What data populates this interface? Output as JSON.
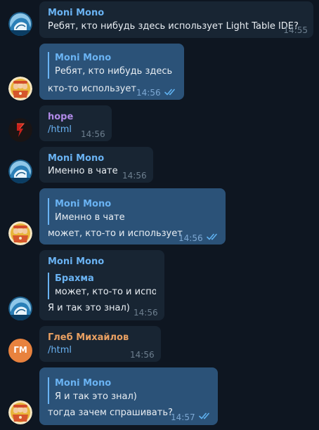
{
  "colors": {
    "background": "#0e1621",
    "incoming_bubble": "#182533",
    "outgoing_bubble": "#2b5278",
    "name_blue": "#6ab3f3",
    "name_purple": "#b18ae8",
    "name_orange": "#e9a062",
    "avatar_orange": "#e8823e"
  },
  "messages": [
    {
      "sender": "Moni Mono",
      "text": "Ребят, кто нибудь здесь использует Light Table IDE?",
      "time": "14:55"
    },
    {
      "reply_to": "Moni Mono",
      "reply_text": "Ребят, кто нибудь здесь ...",
      "text": "кто-то использует",
      "time": "14:56",
      "status": "read-double-check"
    },
    {
      "sender": "hope",
      "text": "/html",
      "time": "14:56"
    },
    {
      "sender": "Moni Mono",
      "text": "Именно в чате",
      "time": "14:56"
    },
    {
      "reply_to": "Moni Mono",
      "reply_text": "Именно в чате",
      "text": "может, кто-то и использует",
      "time": "14:56",
      "status": "read-double-check"
    },
    {
      "sender": "Moni Mono",
      "reply_to": "Брахма",
      "reply_text": "может, кто-то и испо...",
      "text": "Я и так это знал)",
      "time": "14:56"
    },
    {
      "sender": "Глеб Михайлов",
      "avatar_initials": "ГМ",
      "text": "/html",
      "time": "14:56"
    },
    {
      "reply_to": "Moni Mono",
      "reply_text": "Я и так это знал)",
      "text": "тогда зачем спрашивать?",
      "time": "14:57",
      "status": "read-double-check"
    }
  ]
}
